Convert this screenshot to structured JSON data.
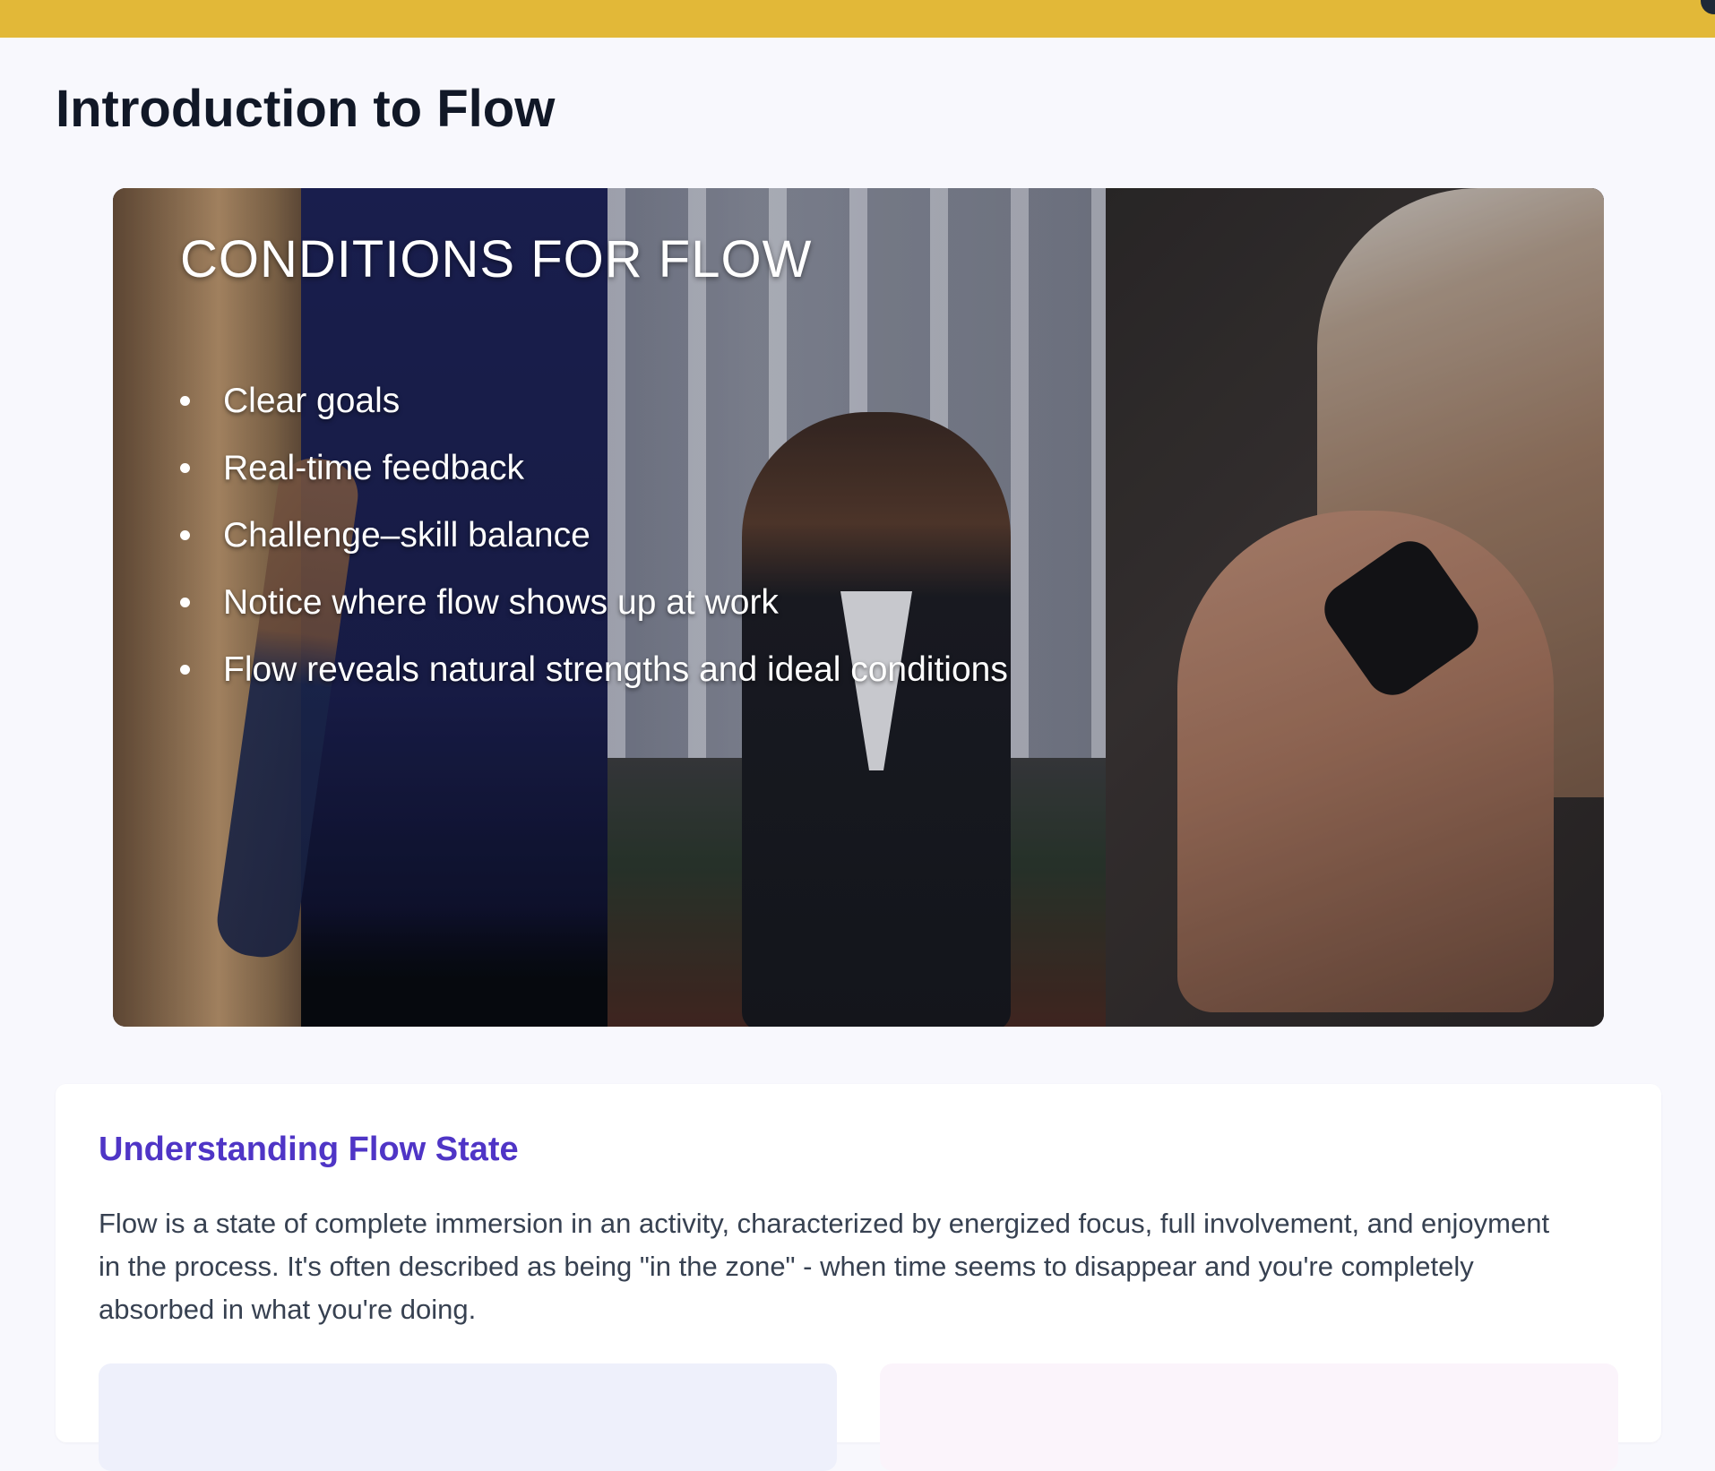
{
  "header": {
    "bar_color": "#e2b838"
  },
  "page": {
    "title": "Introduction to Flow"
  },
  "slide": {
    "title": "CONDITIONS FOR FLOW",
    "bullets": [
      "Clear goals",
      "Real-time feedback",
      "Challenge–skill balance",
      "Notice where flow shows up at work",
      "Flow reveals natural strengths and ideal conditions"
    ]
  },
  "section": {
    "title": "Understanding Flow State",
    "title_color": "#4f35c6",
    "body": "Flow is a state of complete immersion in an activity, characterized by energized focus, full involvement, and enjoyment in the process. It's often described as being \"in the zone\" - when time seems to disappear and you're completely absorbed in what you're doing."
  }
}
